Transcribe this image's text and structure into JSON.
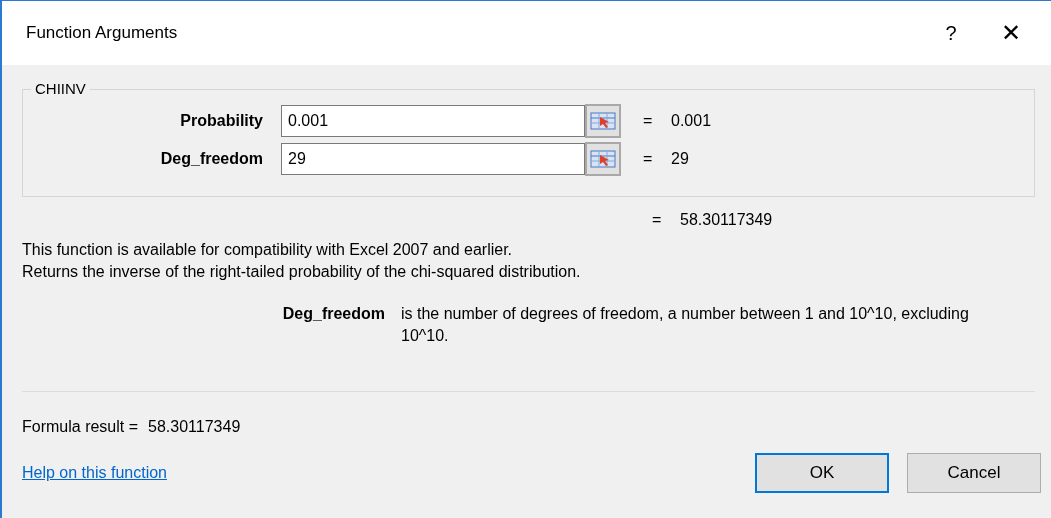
{
  "window": {
    "title": "Function Arguments",
    "help": "?",
    "close": "✕"
  },
  "function_name": "CHIINV",
  "arguments": [
    {
      "label": "Probability",
      "value": "0.001",
      "result": "0.001",
      "focused": false
    },
    {
      "label": "Deg_freedom",
      "value": "29",
      "result": "29",
      "focused": false
    }
  ],
  "equals": "=",
  "result": "58.30117349",
  "description": [
    "This function is available for compatibility with Excel 2007 and earlier.",
    "Returns the inverse of the right-tailed probability of the chi-squared distribution."
  ],
  "argument_help": {
    "label": "Deg_freedom",
    "text": "is the number of degrees of freedom, a number between 1 and 10^10, excluding 10^10."
  },
  "formula_result": {
    "label": "Formula result =",
    "value": "58.30117349"
  },
  "help_link": "Help on this function",
  "buttons": [
    {
      "label": "OK",
      "default": true
    },
    {
      "label": "Cancel",
      "default": false
    }
  ]
}
